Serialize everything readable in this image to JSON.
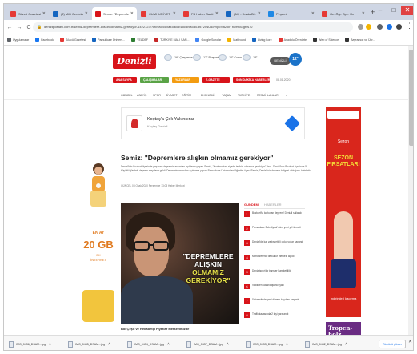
{
  "tabs": [
    {
      "title": "Sözcü Gazetesi - Y",
      "color": "#e53935"
    },
    {
      "title": "(2) Milli Centeks (S...",
      "color": "#1565c0"
    },
    {
      "title": "Semiz: \"Depremle...",
      "color": "#d8141a"
    },
    {
      "title": "CUMHURİYET",
      "color": "#e53935"
    },
    {
      "title": "FB Haber Saati pü...",
      "color": "#e53935"
    },
    {
      "title": "(64) - Kuala Bi...",
      "color": "#1565c0"
    },
    {
      "title": "Peşemi",
      "color": "#1e88e5"
    },
    {
      "title": "Öz. Öğr. Spe. Kır",
      "color": "#e53935"
    }
  ],
  "new_tab": "+",
  "window_controls": [
    "–",
    "□",
    "✕"
  ],
  "address": {
    "lock": "🔒",
    "url": "denizlipostasi.com.tr/semiz-depremlere-aliskin-olmamiz-gerekiyor-1422123/?cfc9a5/c8xa45ac8b1oc8i9a5a03fk72dsU4cWp7bla2kIrTtMfR5Ggtvs72"
  },
  "bookmarks": [
    {
      "label": "Uygulamalar",
      "color": "#5f6368"
    },
    {
      "label": "Facebook",
      "color": "#1877f2"
    },
    {
      "label": "Sözcü Gazetesi",
      "color": "#e53935"
    },
    {
      "label": "Pamukkale Ünivers...",
      "color": "#1565c0"
    },
    {
      "label": "YELDEF",
      "color": "#2e7d32"
    },
    {
      "label": "TÜRKİYE MALİ SAN...",
      "color": "#c62828"
    },
    {
      "label": "Google Scholar",
      "color": "#4285f4"
    },
    {
      "label": "Mathvund",
      "color": "#f4b400"
    },
    {
      "label": "Living Lore",
      "color": "#1565c0"
    },
    {
      "label": "Anadolu Örenörte",
      "color": "#e53935"
    },
    {
      "label": "Web of Science",
      "color": "#333333"
    },
    {
      "label": "Bayramoç ve Ücr...",
      "color": "#333333"
    }
  ],
  "site": {
    "logo": "Denizli",
    "weather": [
      {
        "temp": "-16°",
        "label": "Çarşamba"
      },
      {
        "temp": "-12°",
        "label": "Perşembe"
      },
      {
        "temp": "-16°",
        "label": "Cuma"
      },
      {
        "temp": "-18°",
        "label": "Cumartesi"
      }
    ],
    "city": "DENİZLİ",
    "current_temp": "12°",
    "date": "08.01.2020",
    "categories": [
      {
        "label": "ANA SAYFA",
        "color": "#d8141a"
      },
      {
        "label": "ÇALIŞMALAR",
        "color": "#5aa346"
      },
      {
        "label": "YAZARLAR",
        "color": "#f39c12"
      },
      {
        "label": "E-GAZETE",
        "color": "#d8141a"
      },
      {
        "label": "SON DAKİKA HABERLER",
        "color": "#d8141a"
      }
    ],
    "menu": [
      "GÜNCEL",
      "ASAYİŞ",
      "SPOR",
      "SİYASET",
      "EĞİTİM",
      "EKONOMİ",
      "YAŞAM",
      "TÜRKİYE",
      "RESMİ İLANLAR"
    ]
  },
  "ad_banner": {
    "title": "Koçtaş'a Çok Yakınsınız",
    "subtitle": "Koçtaş Denizli"
  },
  "left_ad": {
    "line1": "EK AY",
    "line2": "20 GB",
    "line3": "EK",
    "line4": "İNTERNET"
  },
  "article": {
    "title": "Semiz: \"Depremlere alışkın olmamız gerekiyor\"",
    "lead": "Denizli'nin Bozkurt ilçesinde yaşanan depremin ardından açıklama yapan Semiz, \"Korkmaktan ziyade tedbirli olmamız gerekiyor\" dedi. Denizli'nin Bozkurt ilçesinde 5 büyüklüğündeki deprem meydana geldi. Depremin ardından açıklama yapan Pamukkale Üniversitesi öğretim üyesi Semiz, Denizli'nin deprem bölgesi olduğunu hatırlattı.",
    "meta": "GÜNCEL  08 Ocak 2020 Perşembe 13:08  Haber Merkezi",
    "quote_white": "\"DEPREMLERE ALIŞKIN",
    "quote_yellow": "OLMAMIZ GEREKİYOR\""
  },
  "below_article": "Bol Çeşit ve Rekabetçi Fiyatlar Merkezimizde",
  "sidebar": {
    "heading": "GÜNDEM",
    "heading_sub": "HABERLER",
    "items": [
      {
        "num": "1",
        "text": "Bozkurt'ta korkutan deprem! Denizli sallandı"
      },
      {
        "num": "2",
        "text": "Pamukkale Belediyesi'nden yeni yıl hizmeti"
      },
      {
        "num": "3",
        "text": "Denizli'de kar yağışı etkili oldu, yollar kapandı"
      },
      {
        "num": "4",
        "text": "Merkezefendi'de kültür merkezi açıldı"
      },
      {
        "num": "5",
        "text": "Denizlispor'da transfer hareketliliği"
      },
      {
        "num": "6",
        "text": "Valilikten vatandaşlara uyarı"
      },
      {
        "num": "7",
        "text": "Üniversitede yeni dönem kayıtları başladı"
      },
      {
        "num": "8",
        "text": "Trafik kazasında 2 kişi yaralandı"
      }
    ]
  },
  "right_ad": {
    "brand": "alışveriş",
    "line1": "Sezon",
    "line2": "SEZON FIRSATLARI",
    "line3": "İndirimleri kaçırma"
  },
  "right_ad2": {
    "text": "Tropen-holz"
  },
  "downloads": [
    "IMG_0436_DSAM...jpg",
    "IMG_0435_DSAM...jpg",
    "IMG_0434_DSAM...jpg",
    "IMG_0437_DSAM...jpg",
    "IMG_0433_DSAM...jpg",
    "IMG_0432_DSAM...jpg"
  ],
  "show_all": "Tümünü göster",
  "colors": {
    "brand_red": "#d8141a",
    "tab_strip": "#cfd6e4"
  }
}
